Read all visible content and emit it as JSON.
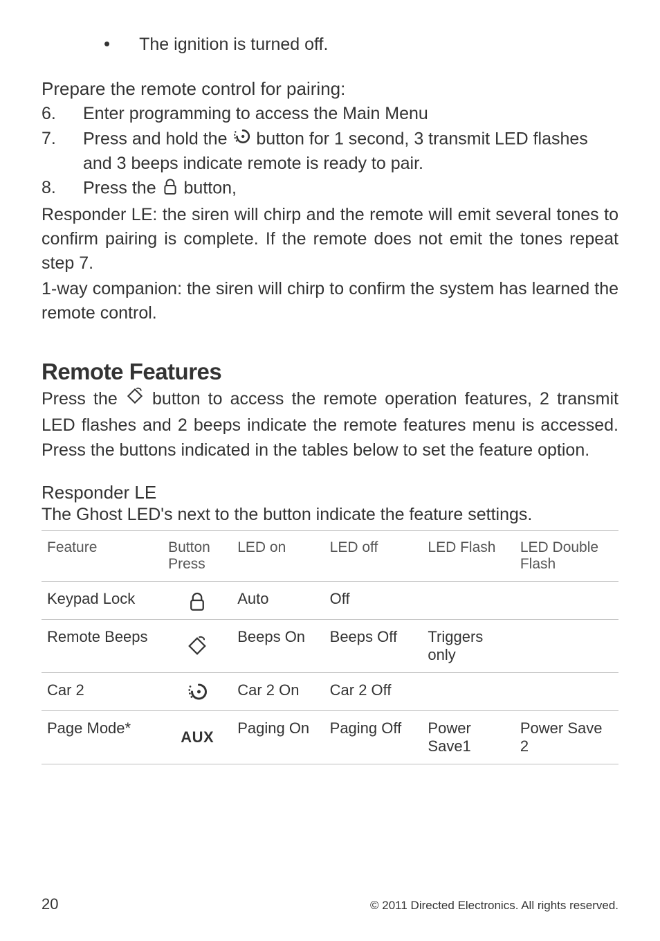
{
  "bullet": "The ignition is turned off.",
  "prepare": {
    "heading": "Prepare the remote control for pairing:",
    "steps": [
      {
        "n": "6.",
        "text": "Enter programming to access the Main Menu"
      },
      {
        "n": "7.",
        "pre": "Press",
        "mid1": " and ",
        "hold": "hold",
        "mid2": " the ",
        "post": " button for 1 second, 3 transmit LED flashes and 3 beeps indicate remote is ready to pair."
      },
      {
        "n": "8.",
        "pre": "Press",
        "mid": " the ",
        "post": " button,"
      }
    ],
    "resp_le": "Responder LE: the siren will chirp and the remote will emit several tones to confirm pairing is complete. If the remote does not emit the tones repeat step 7.",
    "oneway": "1-way companion: the siren will chirp to confirm the system has learned the remote control."
  },
  "remote_features": {
    "heading": "Remote Features",
    "body_pre": "Press",
    "body_mid1": " the ",
    "body_mid2": " button to access the remote operation features, 2 transmit LED flashes and 2 beeps indicate the remote features menu is accessed. ",
    "body_press2": "Press",
    "body_end": " the buttons indicated in the tables below to set the feature option."
  },
  "responder": {
    "heading": "Responder LE",
    "lead": "The Ghost LED's next to the button indicate the feature settings.",
    "headers": [
      "Feature",
      "Button Press",
      "LED on",
      "LED off",
      "LED Flash",
      "LED Double Flash"
    ],
    "rows": [
      {
        "feature": "Keypad Lock",
        "icon": "lock",
        "on": "Auto",
        "off": "Off",
        "flash": "",
        "dflash": ""
      },
      {
        "feature": "Remote Beeps",
        "icon": "diamond",
        "on": "Beeps On",
        "off": "Beeps Off",
        "flash": "Triggers only",
        "dflash": ""
      },
      {
        "feature": "Car 2",
        "icon": "start",
        "on": "Car 2 On",
        "off": "Car 2 Off",
        "flash": "",
        "dflash": ""
      },
      {
        "feature": "Page Mode*",
        "icon": "aux",
        "on": "Paging On",
        "off": "Paging Off",
        "flash": "Power Save1",
        "dflash": "Power Save 2"
      }
    ]
  },
  "footer": {
    "page": "20",
    "copyright": "© 2011 Directed Electronics. All rights reserved."
  },
  "icons": {
    "aux_label": "AUX"
  }
}
